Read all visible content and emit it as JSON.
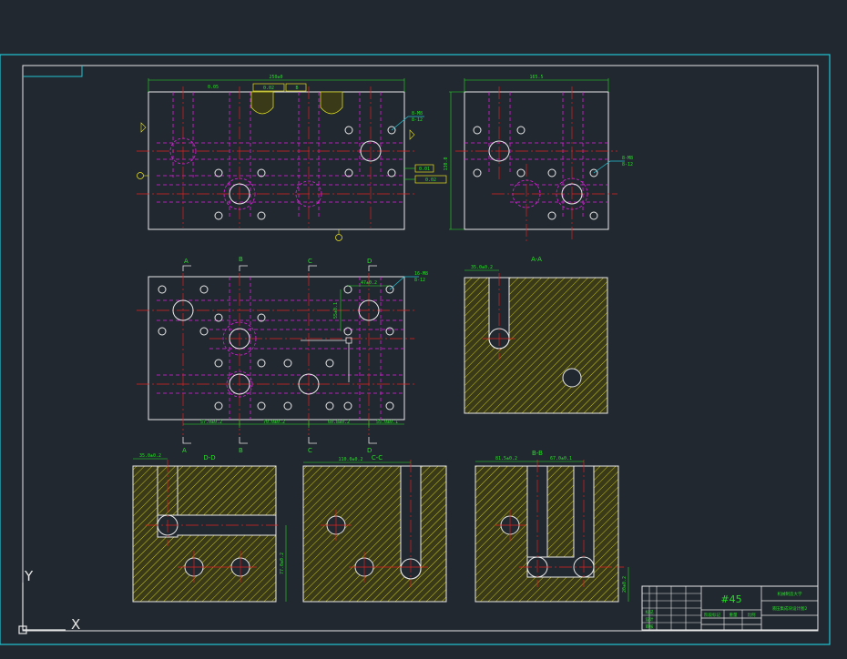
{
  "colors": {
    "background": "#212830",
    "outline": "#e8e8e8",
    "frame": "#22c4d4",
    "centerline": "#e02020",
    "hidden": "#e020e0",
    "dimension": "#24e024",
    "hatch_fill": "#3a3a18",
    "hatch_line": "#d8d820"
  },
  "views": {
    "top_width": "250±0",
    "right_width": "165.5",
    "right_height": "130.0",
    "flatness_tol": "0.05",
    "parallel_tol": "0.02",
    "datum_b": "B",
    "callout_top": "8-M8",
    "callout_top_sub": "8-12",
    "callout_right": "8-M8",
    "callout_right_sub": "8-12",
    "tol_side_1": "0.01",
    "tol_side_2": "0.02",
    "datum_side": "B"
  },
  "middle": {
    "cut_a": "A",
    "cut_b": "B",
    "cut_c": "C",
    "cut_d": "D",
    "dim_top": "47±0.2",
    "dim_vert": "55±0.1",
    "callout": "16-M8",
    "callout_sub": "8-12",
    "dim_1": "57.0±0.2",
    "dim_2": "70.0±0.2",
    "dim_3": "60.8±0.2",
    "dim_4": "55.0±0.1"
  },
  "sections": {
    "aa_title": "A-A",
    "aa_dim": "35.0±0.2",
    "dd_title": "D-D",
    "dd_dim_top": "35.0±0.2",
    "dd_dim_side": "77.0±0.2",
    "cc_title": "C-C",
    "cc_dim_top": "110.0±0.2",
    "bb_title": "B-B",
    "bb_dim_top_1": "81.5±0.2",
    "bb_dim_top_2": "67.0±0.1",
    "bb_dim_side": "20±0.2"
  },
  "title_block": {
    "material": "#45",
    "school": "机械制造大学",
    "drawing_name": "液压集成块设计图2",
    "row_1": "标记",
    "row_2": "设计",
    "row_3": "审核",
    "col_1": "阶段标记",
    "col_2": "重量",
    "col_3": "比例"
  },
  "ucs": {
    "y_label": "Y",
    "x_label": "X"
  }
}
